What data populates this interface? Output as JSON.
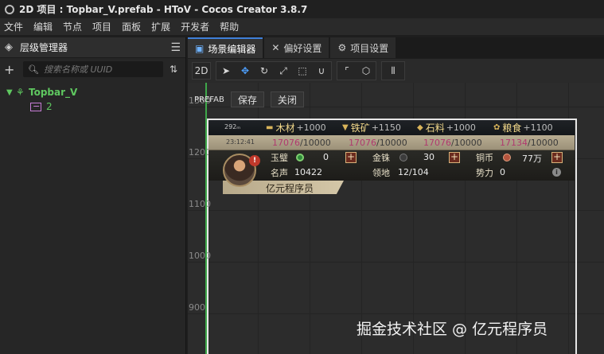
{
  "window": {
    "title": "2D 项目 : Topbar_V.prefab - HToV - Cocos Creator 3.8.7"
  },
  "menu": [
    "文件",
    "编辑",
    "节点",
    "项目",
    "面板",
    "扩展",
    "开发者",
    "帮助"
  ],
  "hierarchy": {
    "title": "层级管理器",
    "search_placeholder": "搜索名称或 UUID",
    "root": "Topbar_V",
    "child": "2"
  },
  "tabs": [
    {
      "label": "场景编辑器",
      "icon": "scene-icon",
      "active": true
    },
    {
      "label": "偏好设置",
      "icon": "wrench-icon",
      "active": false
    },
    {
      "label": "项目设置",
      "icon": "gear-icon",
      "active": false
    }
  ],
  "scene_toolbar": {
    "mode_2d": "2D"
  },
  "prefab_bar": {
    "label": "PREFAB",
    "save": "保存",
    "close": "关闭"
  },
  "ruler": [
    "1300",
    "1200",
    "1100",
    "1000",
    "900"
  ],
  "topbar_ui": {
    "network": "292ₘ",
    "clock": "23:12:41",
    "resources": [
      {
        "name": "木材",
        "gain": "+1000",
        "current": "17076",
        "max": "/10000"
      },
      {
        "name": "铁矿",
        "gain": "+1150",
        "current": "17076",
        "max": "/10000"
      },
      {
        "name": "石料",
        "gain": "+1000",
        "current": "17076",
        "max": "/10000"
      },
      {
        "name": "粮食",
        "gain": "+1100",
        "current": "17134",
        "max": "/10000"
      }
    ],
    "currencies": [
      {
        "name": "玉璧",
        "value": "0"
      },
      {
        "name": "金铢",
        "value": "30"
      },
      {
        "name": "铜币",
        "value": "77万"
      }
    ],
    "stats": [
      {
        "label": "名声",
        "value": "10422"
      },
      {
        "label": "领地",
        "value": "12/104"
      },
      {
        "label": "势力",
        "value": "0"
      }
    ],
    "player_name": "亿元程序员",
    "alert": "!"
  },
  "watermark": "掘金技术社区 @ 亿元程序员",
  "colors": {
    "accent": "#3f7fd9",
    "node_green": "#5fc860",
    "guide_green": "#3ea84a"
  }
}
